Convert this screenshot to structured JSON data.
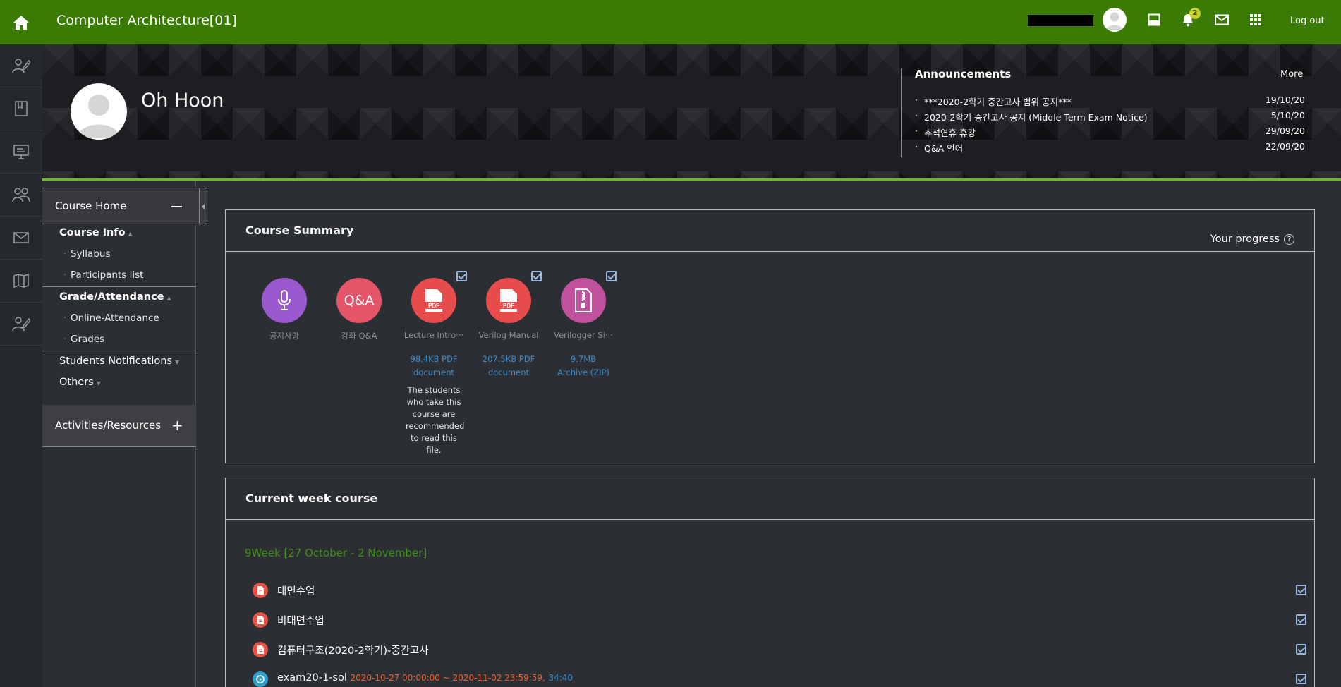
{
  "topbar": {
    "course_title": "Computer Architecture[01]",
    "notification_count": "2",
    "logout_label": "Log out",
    "icons": [
      "home-icon",
      "avatar",
      "layout-icon",
      "bell-icon",
      "mail-icon",
      "apps-grid-icon"
    ],
    "accent": "#3a7b04"
  },
  "rail": {
    "icons": [
      "pencil-user-icon",
      "book-icon",
      "presentation-icon",
      "users-icon",
      "mail-icon",
      "map-icon",
      "pencil-user-icon"
    ]
  },
  "profile": {
    "name": "Oh Hoon"
  },
  "announcements": {
    "title": "Announcements",
    "more_label": "More",
    "items": [
      {
        "title": "***2020-2학기 중간고사 범위 공지***",
        "date": "19/10/20"
      },
      {
        "title": "2020-2학기 중간고사 공지 (Middle Term Exam Notice)",
        "date": "5/10/20"
      },
      {
        "title": "추석연휴 휴강",
        "date": "29/09/20"
      },
      {
        "title": "Q&A 언어",
        "date": "22/09/20"
      }
    ]
  },
  "menu": {
    "head": "Course Home",
    "course_info": "Course Info",
    "syllabus": "Syllabus",
    "participants": "Participants list",
    "grade_attendance": "Grade/Attendance",
    "online_attendance": "Online-Attendance",
    "grades": "Grades",
    "students_notifications": "Students Notifications",
    "others": "Others",
    "activities": "Activities/Resources"
  },
  "summary": {
    "title": "Course Summary",
    "progress_label": "Your progress",
    "activities": [
      {
        "name": "공지사항",
        "icon": "microphone-icon",
        "color": "#9b59d0"
      },
      {
        "name": "강좌 Q&A",
        "icon": "qa-icon",
        "circle_text": "Q&A",
        "color": "#e4556a"
      },
      {
        "name": "Lecture Intro···",
        "icon": "pdf-icon",
        "color": "#e64c4c",
        "size": "98.4KB PDF document",
        "note": "The students who take this course are recommended to read this file."
      },
      {
        "name": "Verilog Manual",
        "icon": "pdf-icon",
        "color": "#e64c4c",
        "size": "207.5KB PDF document"
      },
      {
        "name": "Verilogger Si···",
        "icon": "zip-icon",
        "color": "#c0529d",
        "size": "9.7MB Archive (ZIP)"
      }
    ]
  },
  "current_week": {
    "title": "Current week course",
    "week_label": "9Week [27 October - 2 November]",
    "items": [
      {
        "label": "대면수업",
        "icon": "file-icon"
      },
      {
        "label": "비대면수업",
        "icon": "file-icon"
      },
      {
        "label": "컴퓨터구조(2020-2학기)-중간고사",
        "icon": "file-icon"
      },
      {
        "label": "exam20-1-sol",
        "icon": "video-icon",
        "range": "2020-10-27 00:00:00 ~ 2020-11-02 23:59:59,",
        "duration": "34:40"
      }
    ]
  }
}
